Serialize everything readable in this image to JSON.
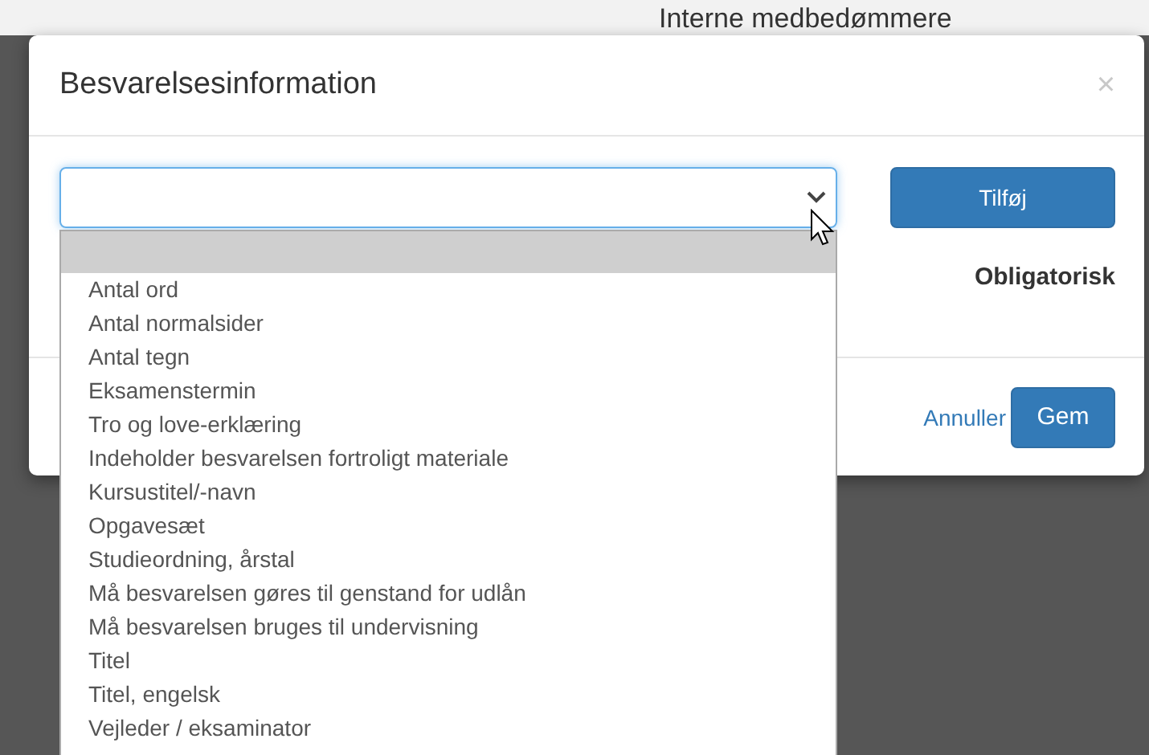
{
  "background": {
    "heading": "Interne medbedømmere"
  },
  "dialog": {
    "title": "Besvarelsesinformation",
    "close": "×",
    "select": {
      "open": true
    },
    "add_button": "Tilføj",
    "required_label": "Obligatorisk",
    "options": [
      {
        "selected": true
      },
      {
        "label": "Antal ord",
        "selected": false
      },
      {
        "label": "Antal normalsider",
        "selected": false
      },
      {
        "label": "Antal tegn",
        "selected": false
      },
      {
        "label": "Eksamenstermin",
        "selected": false
      },
      {
        "label": "Tro og love-erklæring",
        "selected": false
      },
      {
        "label": "Indeholder besvarelsen fortroligt materiale",
        "selected": false
      },
      {
        "label": "Kursustitel/-navn",
        "selected": false
      },
      {
        "label": "Opgavesæt",
        "selected": false
      },
      {
        "label": "Studieordning, årstal",
        "selected": false
      },
      {
        "label": "Må besvarelsen gøres til genstand for udlån",
        "selected": false
      },
      {
        "label": "Må besvarelsen bruges til undervisning",
        "selected": false
      },
      {
        "label": "Titel",
        "selected": false
      },
      {
        "label": "Titel, engelsk",
        "selected": false
      },
      {
        "label": "Vejleder / eksaminator",
        "selected": false
      }
    ],
    "footer": {
      "cancel": "Annuller",
      "save": "Gem"
    }
  }
}
